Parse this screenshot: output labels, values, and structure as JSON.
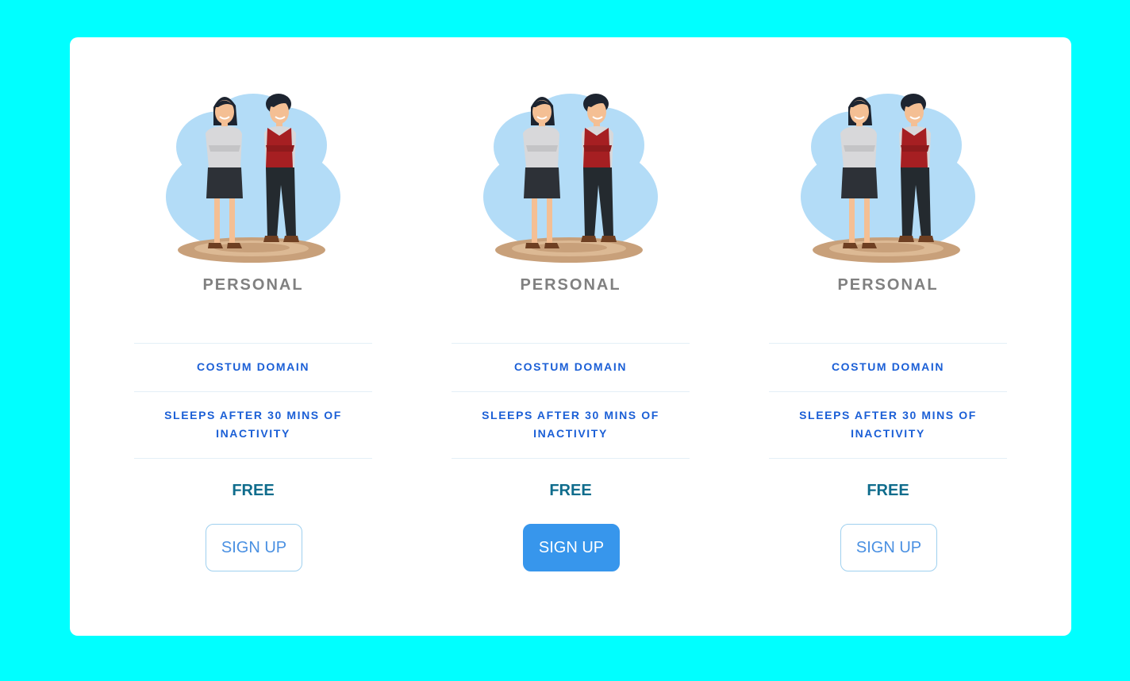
{
  "colors": {
    "background": "#00ffff",
    "panel": "#ffffff",
    "title": "#808080",
    "feature_text": "#1b5fd6",
    "price_text": "#0f6c8c",
    "button_outline": "#9fd0ef",
    "button_active": "#3796ec"
  },
  "plans": [
    {
      "title": "PERSONAL",
      "illustration": "two-people-illustration",
      "features": [
        "COSTUM DOMAIN",
        "SLEEPS AFTER 30 MINS OF INACTIVITY"
      ],
      "price": "FREE",
      "button_label": "SIGN UP",
      "button_state": "outline"
    },
    {
      "title": "PERSONAL",
      "illustration": "two-people-illustration",
      "features": [
        "COSTUM DOMAIN",
        "SLEEPS AFTER 30 MINS OF INACTIVITY"
      ],
      "price": "FREE",
      "button_label": "SIGN UP",
      "button_state": "filled"
    },
    {
      "title": "PERSONAL",
      "illustration": "two-people-illustration",
      "features": [
        "COSTUM DOMAIN",
        "SLEEPS AFTER 30 MINS OF INACTIVITY"
      ],
      "price": "FREE",
      "button_label": "SIGN UP",
      "button_state": "outline"
    }
  ]
}
